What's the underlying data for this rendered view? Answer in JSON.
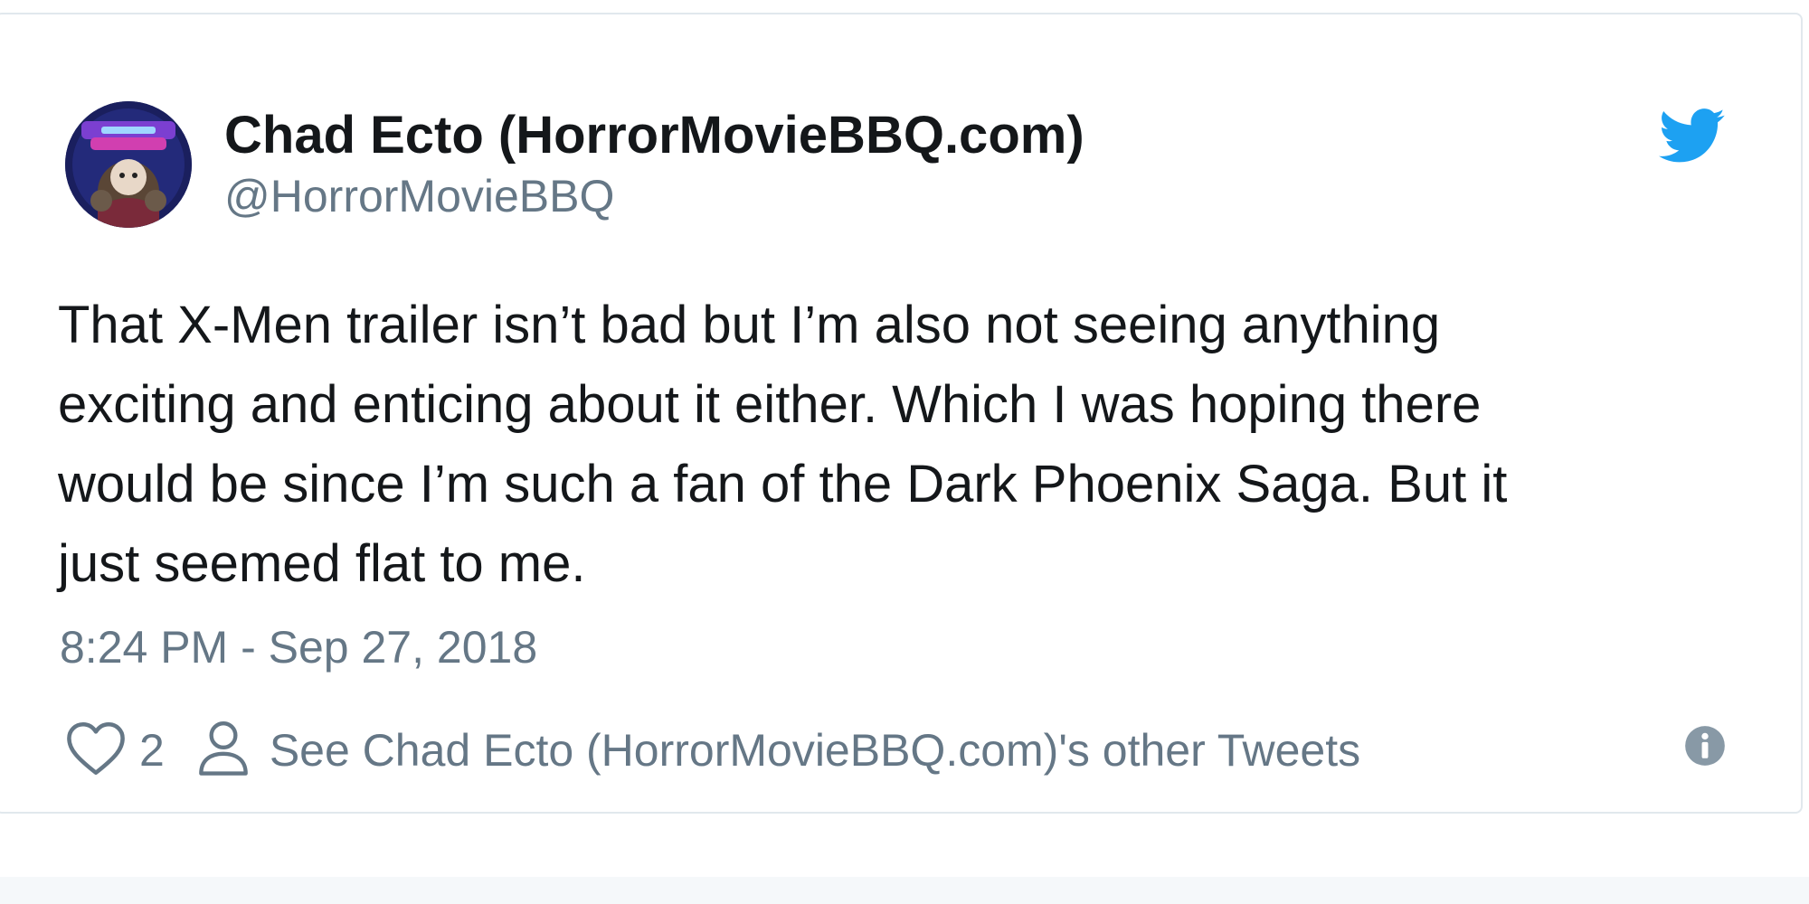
{
  "tweet": {
    "author": {
      "display_name": "Chad Ecto (HorrorMovieBBQ.com)",
      "handle": "@HorrorMovieBBQ"
    },
    "text": "That X-Men trailer isn’t bad but I’m also not seeing anything\nexciting and enticing about it either. Which I was hoping there\nwould be since I’m such a fan of the Dark Phoenix Saga. But it\njust seemed flat to me.",
    "timestamp": "8:24 PM - Sep 27, 2018",
    "likes": "2",
    "other_tweets_label": "See Chad Ecto (HorrorMovieBBQ.com)'s other Tweets"
  },
  "icons": {
    "brand": "twitter-bird-icon",
    "like": "heart-icon",
    "profile": "person-icon",
    "info": "info-icon"
  },
  "colors": {
    "twitter_blue": "#1da1f2",
    "text_primary": "#14171a",
    "text_secondary": "#657786",
    "border": "#e1e8ed",
    "avatar_bg": "#1a1f5e"
  }
}
